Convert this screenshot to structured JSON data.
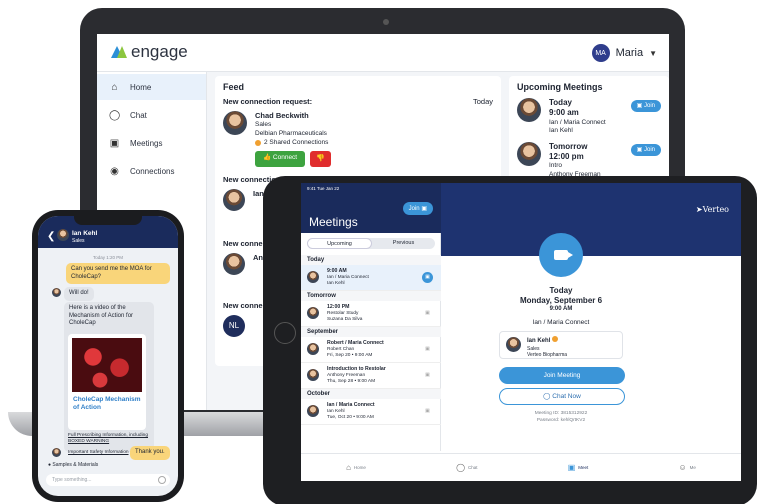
{
  "laptop": {
    "logo_text": "engage",
    "user_initials": "MA",
    "user_name": "Maria",
    "nav": [
      {
        "label": "Home",
        "icon": "home-icon"
      },
      {
        "label": "Chat",
        "icon": "chat-icon"
      },
      {
        "label": "Meetings",
        "icon": "video-icon"
      },
      {
        "label": "Connections",
        "icon": "connections-icon"
      }
    ],
    "feed": {
      "title": "Feed",
      "request_label": "New connection request:",
      "request_time": "Today",
      "person_name": "Chad Beckwith",
      "person_role": "Sales",
      "person_company": "Delbian Pharmaceuticals",
      "shared": "2 Shared Connections",
      "connect_label": "Connect",
      "sec2": "New connection",
      "sec3": "New conne",
      "sec4": "New conne",
      "nl_initials": "NL",
      "row2_name": "Ian",
      "row3_name": "An"
    },
    "upcoming": {
      "title": "Upcoming Meetings",
      "items": [
        {
          "day": "Today",
          "time": "9:00 am",
          "who": "Ian / Maria Connect",
          "host": "Ian Kehl",
          "join": "Join"
        },
        {
          "day": "Tomorrow",
          "time": "12:00 pm",
          "who": "Intro",
          "host": "Anthony Freeman",
          "join": "Join"
        }
      ]
    }
  },
  "phone": {
    "contact_name": "Ian Kehl",
    "contact_role": "Sales",
    "today_label": "Today 1:20 PM",
    "msg1": "Can you send me the MOA for CholeCap?",
    "msg2": "Will do!",
    "msg3": "Here is a video of the Mechanism of Action for CholeCap",
    "video_title": "CholeCap Mechanism of Action",
    "link1": "Full Prescribing Information, including BOXED WARNING",
    "link2": "Important Safety Information",
    "msg4": "Thank you.",
    "samples": "Samples & Materials",
    "input_placeholder": "Type something..."
  },
  "tablet": {
    "status": "9:41 Tue Jan 22",
    "title": "Meetings",
    "join": "Join",
    "tabs": [
      "Upcoming",
      "Previous"
    ],
    "sections": [
      {
        "label": "Today",
        "items": [
          {
            "title": "9:00 AM",
            "l2": "Ian / Maria Connect",
            "l3": "Ian Kehl",
            "selected": true
          }
        ]
      },
      {
        "label": "Tomorrow",
        "items": [
          {
            "title": "12:00 PM",
            "l2": "Restolar Study",
            "l3": "Suzana Da Silva",
            "selected": false
          }
        ]
      },
      {
        "label": "September",
        "items": [
          {
            "title": "Robert / Maria Connect",
            "l2": "Robert Chan",
            "l3": "Fri, Sep 20 • 9:00 AM",
            "selected": false
          },
          {
            "title": "Introduction to Restolar",
            "l2": "Anthony Freeman",
            "l3": "Thu, Sep 28 • 9:00 AM",
            "selected": false
          }
        ]
      },
      {
        "label": "October",
        "items": [
          {
            "title": "Ian / Maria Connect",
            "l2": "Ian Kehl",
            "l3": "Tue, Oct 20 • 9:00 AM",
            "selected": false
          }
        ]
      }
    ],
    "brand": "Verteo",
    "detail": {
      "day": "Today",
      "date": "Monday, September 6",
      "time": "9:00 AM",
      "name": "Ian / Maria Connect",
      "person": "Ian Kehl",
      "role": "Sales",
      "company": "Verteo Biopharma",
      "join_label": "Join Meeting",
      "chat_label": "Chat Now",
      "meeting_id": "Meeting ID: 3815312922",
      "password": "Password: kehlQrtKV2"
    },
    "bottom_nav": [
      "Home",
      "Chat",
      "Meet",
      "Me"
    ]
  }
}
